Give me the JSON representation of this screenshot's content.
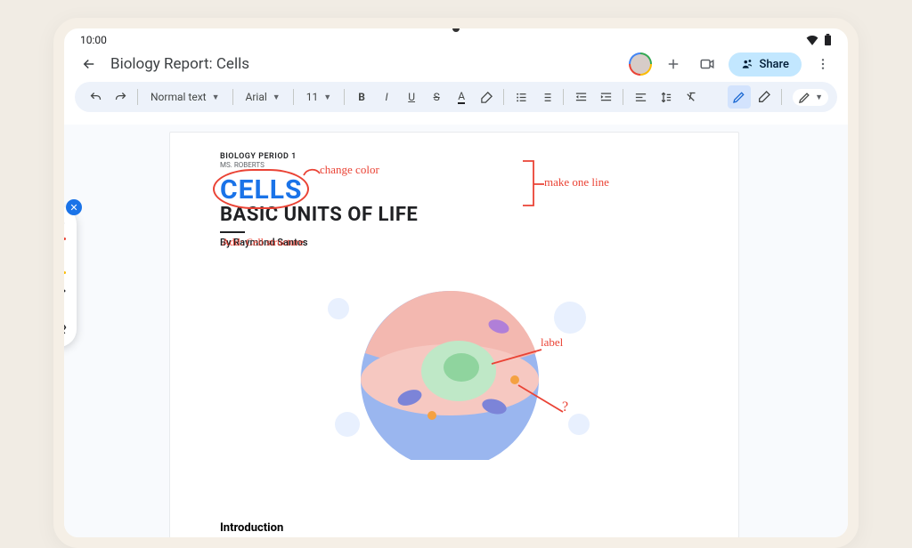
{
  "status": {
    "time": "10:00"
  },
  "header": {
    "title": "Biology Report: Cells",
    "share_label": "Share"
  },
  "toolbar": {
    "style_label": "Normal text",
    "font_label": "Arial",
    "size_label": "11"
  },
  "document": {
    "course_line": "BIOLOGY PERIOD 1",
    "teacher_line": "MS. ROBERTS",
    "title_main": "CELLS",
    "title_sub": "BASIC UNITS OF LIFE",
    "byline": "By Raymond Santos",
    "section_intro": "Introduction"
  },
  "annotations": {
    "change_color": "change color",
    "make_one_line": "make one line",
    "add_structure": "Add: Cell structure",
    "label": "label",
    "question": "?"
  }
}
